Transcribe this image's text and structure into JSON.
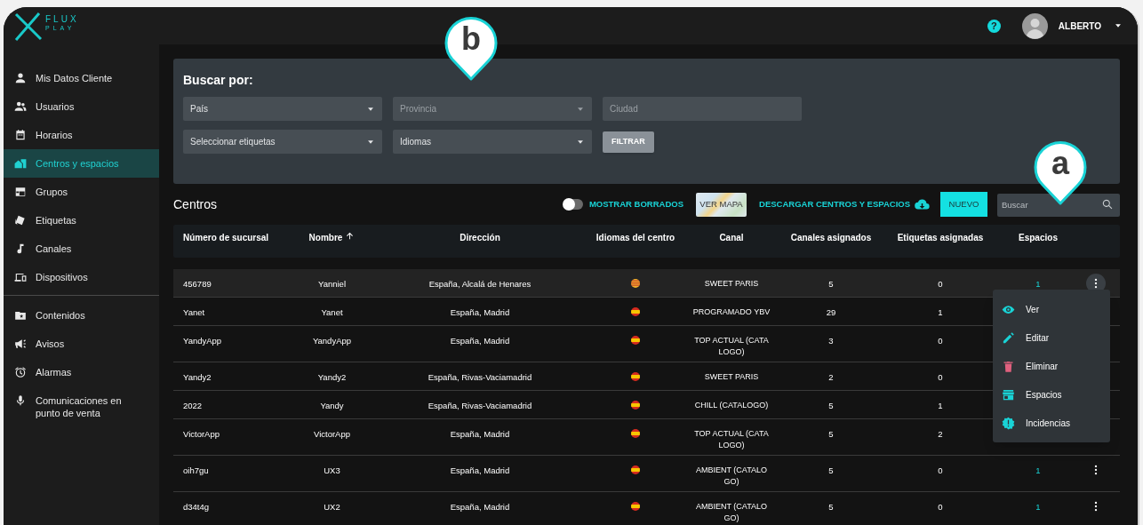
{
  "logo": {
    "line_1": "FLUX",
    "line_2": "PLAY"
  },
  "header": {
    "help": "?",
    "user": "ALBERTO"
  },
  "sidebar": {
    "sections": [
      [
        {
          "label": "Mis Datos Cliente",
          "selected": false
        },
        {
          "label": "Usuarios",
          "selected": false
        },
        {
          "label": "Horarios",
          "selected": false
        },
        {
          "label": "Centros y espacios",
          "selected": true
        },
        {
          "label": "Grupos",
          "selected": false
        },
        {
          "label": "Etiquetas",
          "selected": false
        },
        {
          "label": "Canales",
          "selected": false
        },
        {
          "label": "Dispositivos",
          "selected": false
        }
      ],
      [
        {
          "label": "Contenidos",
          "selected": false
        },
        {
          "label": "Avisos",
          "selected": false
        },
        {
          "label": "Alarmas",
          "selected": false
        },
        {
          "label": "Comunicaciones en punto de venta",
          "selected": false
        }
      ]
    ]
  },
  "filters": {
    "title": "Buscar por:",
    "fields": [
      {
        "kind": "select",
        "label": "País",
        "disabled": false
      },
      {
        "kind": "select",
        "label": "Provincia",
        "disabled": true
      },
      {
        "kind": "text",
        "placeholder": "Ciudad"
      },
      {
        "kind": "select",
        "label": "Seleccionar etiquetas",
        "disabled": false
      },
      {
        "kind": "select",
        "label": "Idiomas",
        "disabled": false
      },
      {
        "kind": "button",
        "label": "FILTRAR"
      }
    ]
  },
  "toolbar": {
    "title": "Centros",
    "show_deleted": {
      "label": "MOSTRAR BORRADOS",
      "on": false
    },
    "map_button": "VER MAPA",
    "download": "DESCARGAR CENTROS Y ESPACIOS",
    "new_button": "NUEVO",
    "search": {
      "placeholder": "Buscar"
    }
  },
  "table": {
    "columns": [
      {
        "label": "Número de sucursal",
        "sorted": false
      },
      {
        "label": "Nombre",
        "sorted": true
      },
      {
        "label": "Dirección",
        "sorted": false
      },
      {
        "label": "Idiomas del centro",
        "sorted": false
      },
      {
        "label": "Canal",
        "sorted": false
      },
      {
        "label": "Canales asignados",
        "sorted": false
      },
      {
        "label": "Etiquetas asignadas",
        "sorted": false
      },
      {
        "label": "Espacios",
        "sorted": false
      }
    ],
    "rows": [
      {
        "number": "456789",
        "name": "Yanniel",
        "address": "España, Alcalá de Henares",
        "kind": "catalan",
        "channel": "SWEET PARIS",
        "channels": "5",
        "tags": "0",
        "spaces": "1",
        "selected": true,
        "actions": true
      },
      {
        "number": "Yanet",
        "name": "Yanet",
        "address": "España, Madrid",
        "kind": "spain",
        "channel": "PROGRAMADO YBV",
        "channels": "29",
        "tags": "1",
        "selected": false,
        "actions": false
      },
      {
        "number": "YandyApp",
        "name": "YandyApp",
        "address": "España, Madrid",
        "kind": "spain",
        "channel": "TOP ACTUAL (CATALOGO)",
        "channels": "3",
        "tags": "0",
        "selected": false,
        "actions": false
      },
      {
        "number": "Yandy2",
        "name": "Yandy2",
        "address": "España, Rivas-Vaciamadrid",
        "kind": "spain",
        "channel": "SWEET PARIS",
        "channels": "2",
        "tags": "0",
        "selected": false,
        "actions": false
      },
      {
        "number": "2022",
        "name": "Yandy",
        "address": "España, Rivas-Vaciamadrid",
        "kind": "spain",
        "channel": "CHILL (CATALOGO)",
        "channels": "5",
        "tags": "1",
        "selected": false,
        "actions": false
      },
      {
        "number": "VictorApp",
        "name": "VictorApp",
        "address": "España, Madrid",
        "kind": "spain",
        "channel": "TOP ACTUAL (CATALOGO)",
        "channels": "5",
        "tags": "2",
        "selected": false,
        "actions": false
      },
      {
        "number": "oih7gu",
        "name": "UX3",
        "address": "España, Madrid",
        "kind": "spain",
        "channel": "AMBIENT (CATALOGO)",
        "channels": "5",
        "tags": "0",
        "spaces": "1",
        "selected": false,
        "actions": true
      },
      {
        "number": "d34t4g",
        "name": "UX2",
        "address": "España, Madrid",
        "kind": "spain",
        "channel": "AMBIENT (CATALOGO)",
        "channels": "5",
        "tags": "0",
        "spaces": "1",
        "selected": false,
        "actions": true
      }
    ]
  },
  "row_menu": [
    {
      "label": "Ver"
    },
    {
      "label": "Editar"
    },
    {
      "label": "Eliminar"
    },
    {
      "label": "Espacios"
    },
    {
      "label": "Incidencias"
    }
  ],
  "callouts": [
    {
      "label": "b"
    },
    {
      "label": "a"
    }
  ]
}
